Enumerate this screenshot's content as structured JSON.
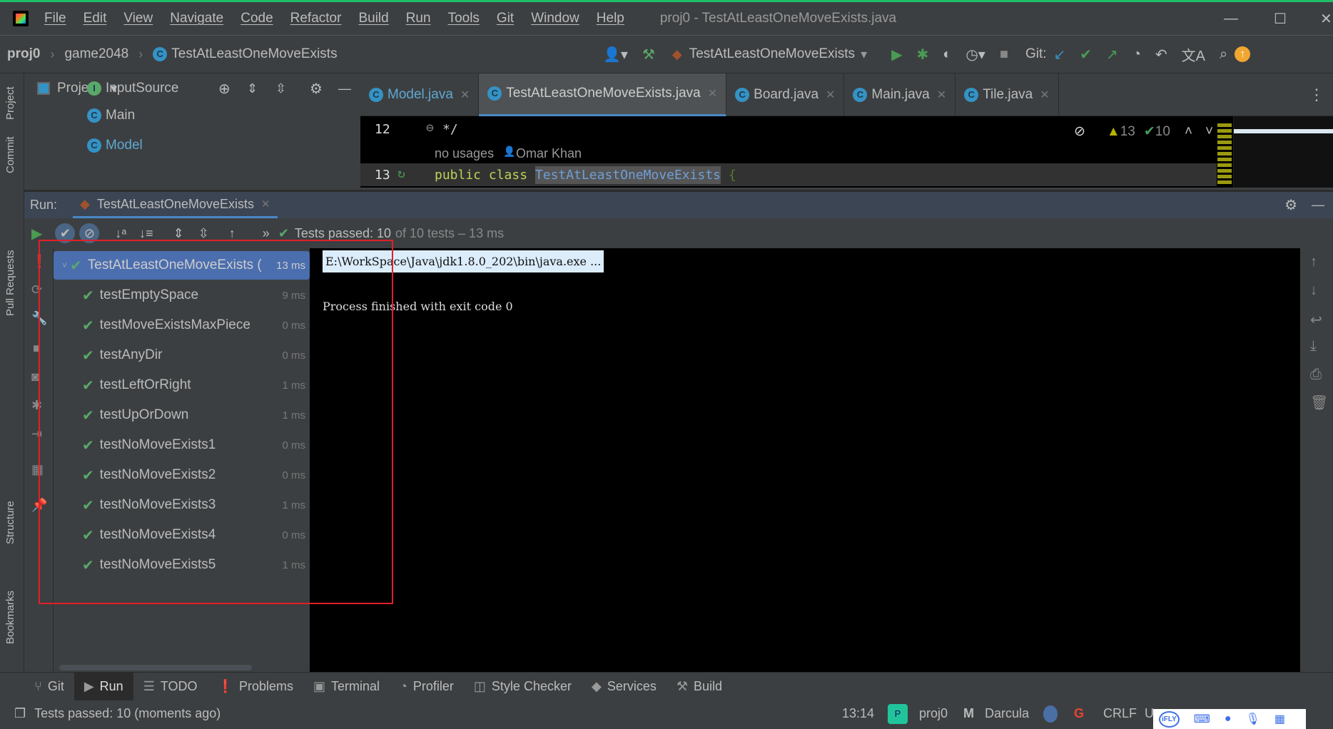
{
  "window": {
    "title": "proj0 - TestAtLeastOneMoveExists.java",
    "accent_top": "#1fbf6a"
  },
  "menu": [
    "File",
    "Edit",
    "View",
    "Navigate",
    "Code",
    "Refactor",
    "Build",
    "Run",
    "Tools",
    "Git",
    "Window",
    "Help"
  ],
  "breadcrumb": [
    "proj0",
    "game2048",
    "TestAtLeastOneMoveExists"
  ],
  "toolbar": {
    "run_config": "TestAtLeastOneMoveExists",
    "git_label": "Git:"
  },
  "left_strip": [
    "Project",
    "Commit",
    "Pull Requests",
    "Structure",
    "Bookmarks"
  ],
  "project_panel": {
    "title": "Project",
    "items": [
      "InputSource",
      "Main",
      "Model"
    ]
  },
  "editor_tabs": [
    {
      "label": "Model.java",
      "active": false
    },
    {
      "label": "TestAtLeastOneMoveExists.java",
      "active": true
    },
    {
      "label": "Board.java",
      "active": false
    },
    {
      "label": "Main.java",
      "active": false
    },
    {
      "label": "Tile.java",
      "active": false
    }
  ],
  "editor": {
    "line12_num": "12",
    "line12_text": "*/",
    "hint_usages": "no usages",
    "hint_author": "Omar Khan",
    "line13_num": "13",
    "kw1": "public",
    "kw2": "class",
    "class_name": "TestAtLeastOneMoveExists",
    "brace": "{",
    "warnings": "13",
    "checks": "10"
  },
  "run": {
    "label": "Run:",
    "tab": "TestAtLeastOneMoveExists",
    "status_prefix": "Tests passed: 10",
    "status_suffix": "of 10 tests – 13 ms",
    "root": {
      "name": "TestAtLeastOneMoveExists (",
      "time": "13 ms"
    },
    "tests": [
      {
        "name": "testEmptySpace",
        "time": "9 ms"
      },
      {
        "name": "testMoveExistsMaxPiece",
        "time": "0 ms"
      },
      {
        "name": "testAnyDir",
        "time": "0 ms"
      },
      {
        "name": "testLeftOrRight",
        "time": "1 ms"
      },
      {
        "name": "testUpOrDown",
        "time": "1 ms"
      },
      {
        "name": "testNoMoveExists1",
        "time": "0 ms"
      },
      {
        "name": "testNoMoveExists2",
        "time": "0 ms"
      },
      {
        "name": "testNoMoveExists3",
        "time": "1 ms"
      },
      {
        "name": "testNoMoveExists4",
        "time": "0 ms"
      },
      {
        "name": "testNoMoveExists5",
        "time": "1 ms"
      }
    ],
    "console": [
      "E:\\WorkSpace\\Java\\jdk1.8.0_202\\bin\\java.exe ...",
      "Process finished with exit code 0"
    ]
  },
  "bottom_tabs": [
    "Git",
    "Run",
    "TODO",
    "Problems",
    "Terminal",
    "Profiler",
    "Style Checker",
    "Services",
    "Build"
  ],
  "status": {
    "message": "Tests passed: 10 (moments ago)",
    "time": "13:14",
    "project": "proj0",
    "theme": "Darcula",
    "line_sep": "CRLF",
    "encoding_partial": "U",
    "ime_badge": "iFLY"
  }
}
